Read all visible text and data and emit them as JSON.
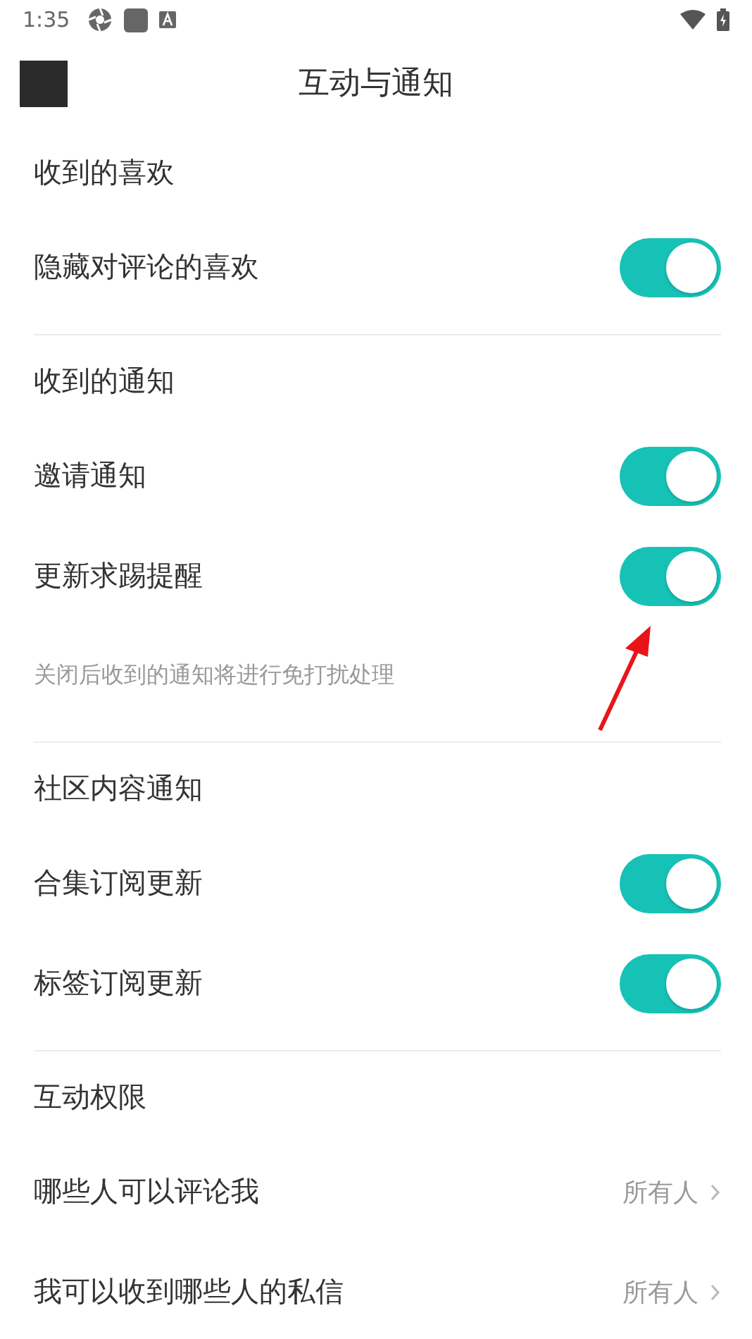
{
  "status_bar": {
    "time": "1:35"
  },
  "header": {
    "title": "互动与通知"
  },
  "sections": [
    {
      "title": "收到的喜欢",
      "items": [
        {
          "kind": "toggle",
          "label": "隐藏对评论的喜欢",
          "on": true
        }
      ]
    },
    {
      "title": "收到的通知",
      "items": [
        {
          "kind": "toggle",
          "label": "邀请通知",
          "on": true
        },
        {
          "kind": "toggle",
          "label": "更新求踢提醒",
          "on": true
        },
        {
          "kind": "note",
          "label": "关闭后收到的通知将进行免打扰处理"
        }
      ]
    },
    {
      "title": "社区内容通知",
      "items": [
        {
          "kind": "toggle",
          "label": "合集订阅更新",
          "on": true
        },
        {
          "kind": "toggle",
          "label": "标签订阅更新",
          "on": true
        }
      ]
    },
    {
      "title": "互动权限",
      "items": [
        {
          "kind": "choice",
          "label": "哪些人可以评论我",
          "value": "所有人"
        },
        {
          "kind": "choice",
          "label": "我可以收到哪些人的私信",
          "value": "所有人"
        }
      ]
    }
  ]
}
